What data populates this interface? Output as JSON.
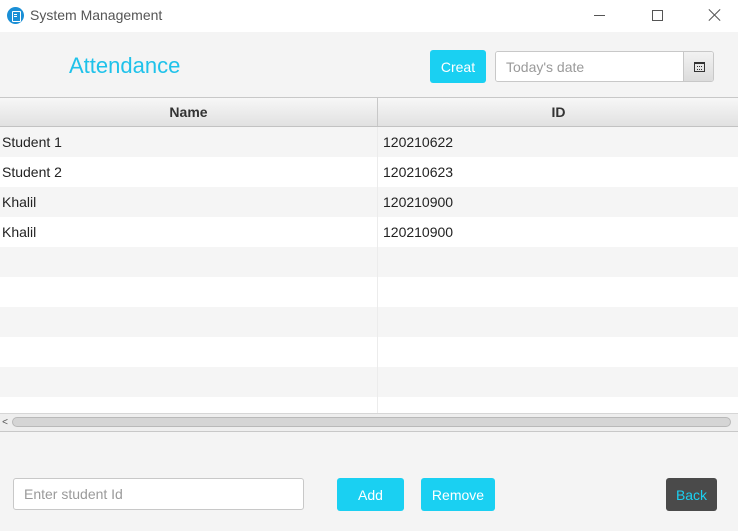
{
  "window": {
    "title": "System Management",
    "icon": "app-notebook-icon"
  },
  "header": {
    "heading": "Attendance",
    "creat_label": "Creat",
    "date_placeholder": "Today's date",
    "calendar_icon": "calendar-icon"
  },
  "table": {
    "columns": [
      "Name",
      "ID"
    ],
    "rows": [
      [
        "Student 1",
        "120210622"
      ],
      [
        "Student 2",
        "120210623"
      ],
      [
        "Khalil",
        "120210900"
      ],
      [
        "Khalil",
        "120210900"
      ]
    ],
    "scroll_left_glyph": "<"
  },
  "footer": {
    "student_id_placeholder": "Enter student Id",
    "add_label": "Add",
    "remove_label": "Remove",
    "back_label": "Back"
  },
  "colors": {
    "accent": "#1ad0f2",
    "heading": "#1fc2ea",
    "back_button_bg": "#4a4a4a"
  }
}
